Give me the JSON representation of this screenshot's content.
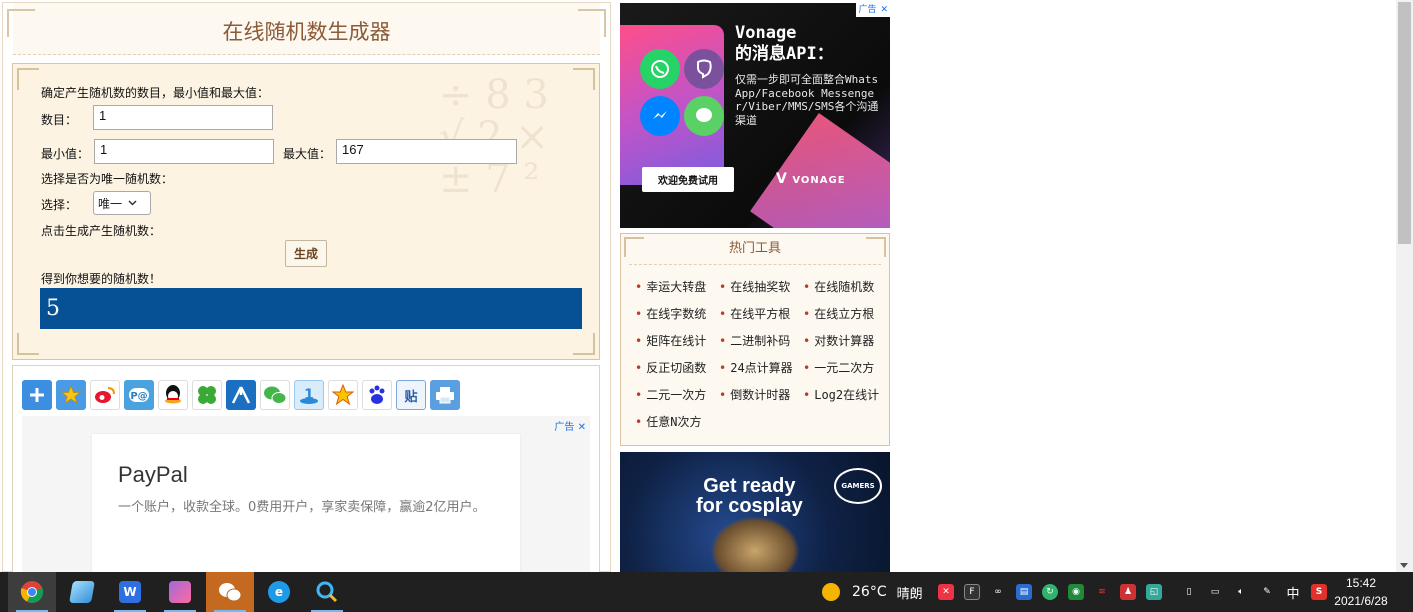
{
  "page": {
    "title": "在线随机数生成器"
  },
  "form": {
    "intro": "确定产生随机数的数目，最小值和最大值：",
    "count_label": "数目：",
    "count_value": "1",
    "min_label": "最小值：",
    "min_value": "1",
    "max_label": "最大值：",
    "max_value": "167",
    "unique_prompt": "选择是否为唯一随机数：",
    "select_label": "选择：",
    "select_value": "唯一",
    "generate_prompt": "点击生成产生随机数：",
    "generate_button": "生成",
    "result_prompt": "得到你想要的随机数！",
    "result_value": "5"
  },
  "share": {
    "icons": [
      "add-icon",
      "favorite-star-icon",
      "weibo-icon",
      "pengyou-icon",
      "qq-icon",
      "clover-icon",
      "renren-icon",
      "wechat-icon",
      "kaixin-icon",
      "qzone-star-icon",
      "baidu-paw-icon",
      "tieba-icon",
      "print-icon"
    ],
    "tieba_text": "贴"
  },
  "ads": {
    "ad_label": "广告",
    "paypal": {
      "name": "PayPal",
      "desc": "一个账户，收款全球。0费用开户，享家卖保障，赢逾2亿用户。"
    },
    "vonage": {
      "headline_1": "Vonage",
      "headline_2": "的消息API：",
      "body": "仅需一步即可全面整合WhatsApp/Facebook Messenger/Viber/MMS/SMS各个沟通渠道",
      "cta": "欢迎免费试用",
      "brand": "VONAGE"
    },
    "cosplay": {
      "line_1": "Get ready",
      "line_2": "for cosplay",
      "badge": "GAMERS"
    }
  },
  "hot_tools": {
    "title": "热门工具",
    "items": [
      "幸运大转盘",
      "在线抽奖软",
      "在线随机数",
      "在线字数统",
      "在线平方根",
      "在线立方根",
      "矩阵在线计",
      "二进制补码",
      "对数计算器",
      "反正切函数",
      "24点计算器",
      "一元二次方",
      "二元一次方",
      "倒数计时器",
      "Log2在线计",
      "任意N次方"
    ]
  },
  "taskbar": {
    "weather_temp": "26°C",
    "weather_text": "晴朗",
    "ime": "中",
    "time": "15:42",
    "date": "2021/6/28"
  },
  "colors": {
    "result_bg": "#065196",
    "title_brown": "#8c5a36",
    "form_bg": "#fcf3e3"
  }
}
